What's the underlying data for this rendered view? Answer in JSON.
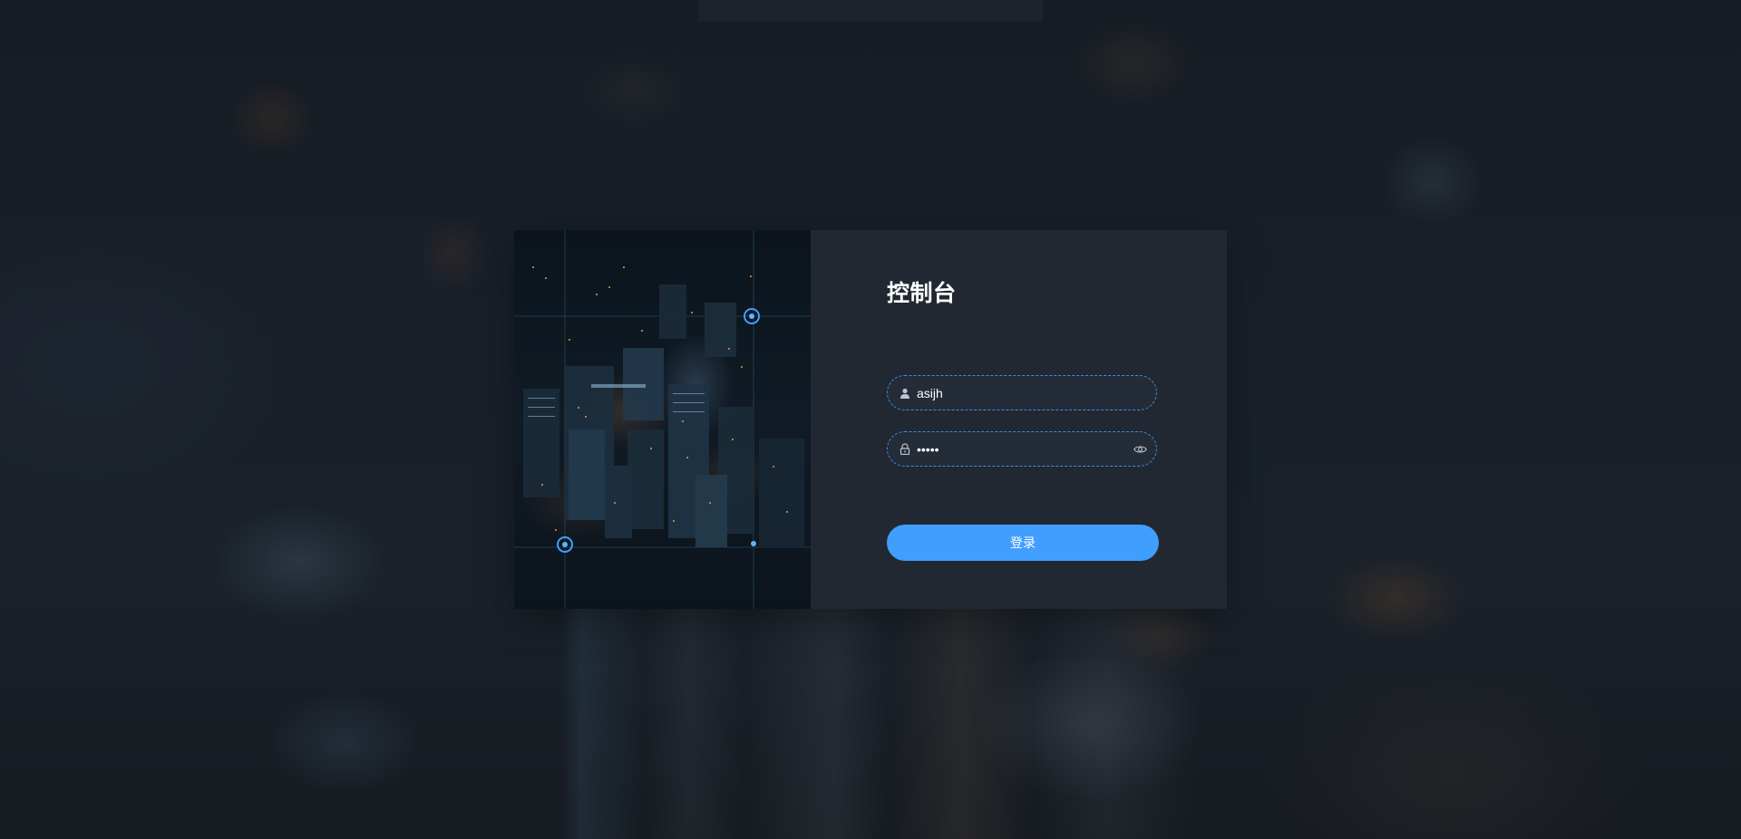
{
  "login": {
    "title": "控制台",
    "username": {
      "value": "asijh",
      "icon": "user-icon"
    },
    "password": {
      "value": "•••••",
      "icon": "lock-icon",
      "toggle_icon": "eye-icon"
    },
    "submit_label": "登录"
  },
  "colors": {
    "accent": "#409eff",
    "card_bg": "#212832",
    "field_border": "#3a8ee6",
    "page_bg": "#141a21"
  }
}
